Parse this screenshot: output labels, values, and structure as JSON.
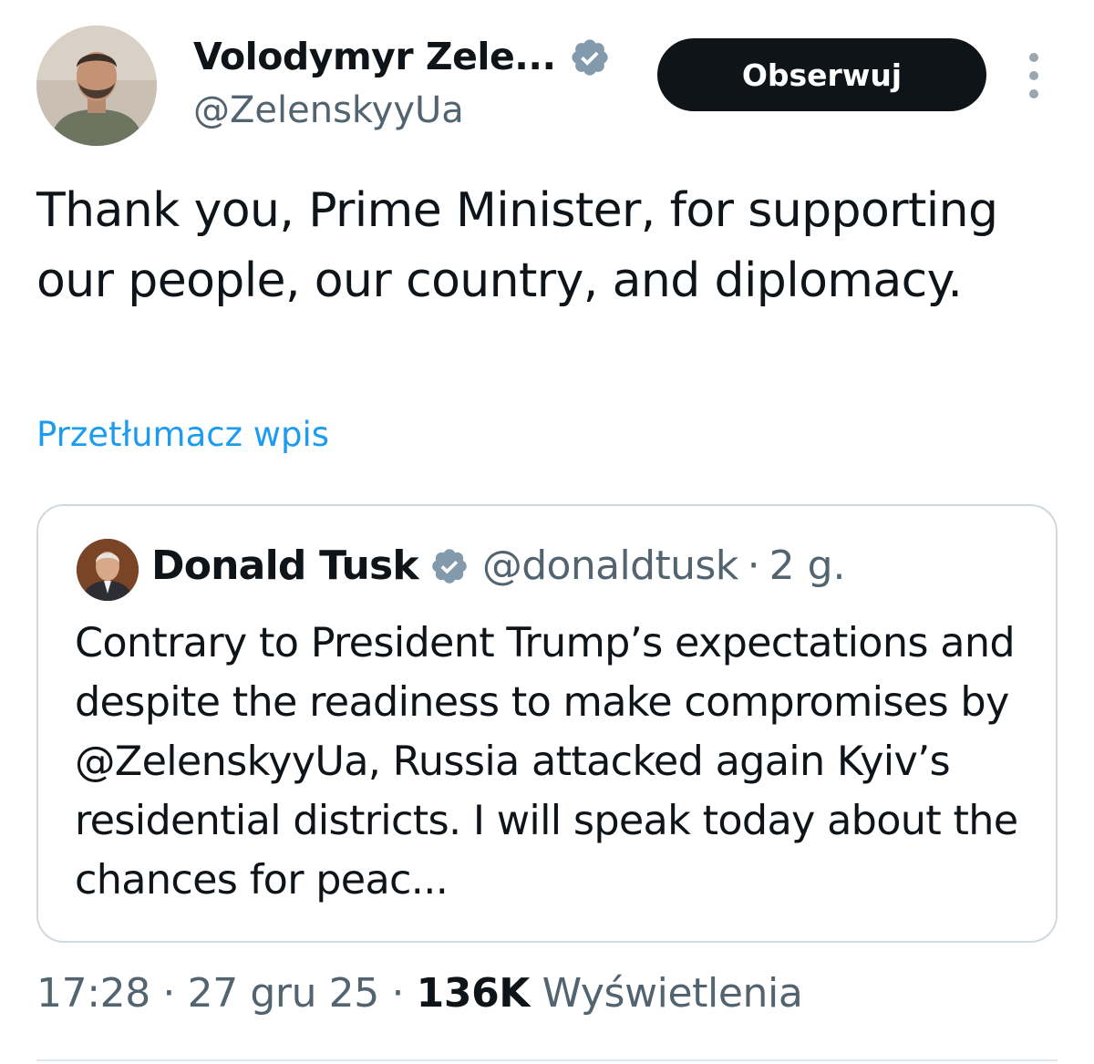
{
  "author": {
    "display_name": "Volodymyr Zele...",
    "handle": "@ZelenskyyUa",
    "verified_icon": "verified-badge-icon",
    "verified_color": "#829aab"
  },
  "follow_button": {
    "label": "Obserwuj"
  },
  "more_menu": {
    "icon": "more-vertical-icon"
  },
  "tweet": {
    "text": "Thank you, Prime Minister, for supporting our people, our country, and diplomacy.",
    "translate_label": "Przetłumacz wpis"
  },
  "quoted_tweet": {
    "display_name": "Donald Tusk",
    "handle": "@donaldtusk",
    "separator": "·",
    "time": "2 g.",
    "text": "Contrary to President Trump’s expectations and despite the readiness to make compromises by @ZelenskyyUa, Russia attacked again Kyiv’s residential districts. I will speak today about the chances for peac..."
  },
  "meta": {
    "time": "17:28",
    "separator": "·",
    "date": "27 gru 25",
    "views_count": "136K",
    "views_label": "Wyświetlenia"
  },
  "colors": {
    "text_primary": "#0f1419",
    "text_secondary": "#536471",
    "link": "#1d9bf0",
    "button_bg": "#0f1419",
    "border": "#cfd9de"
  }
}
